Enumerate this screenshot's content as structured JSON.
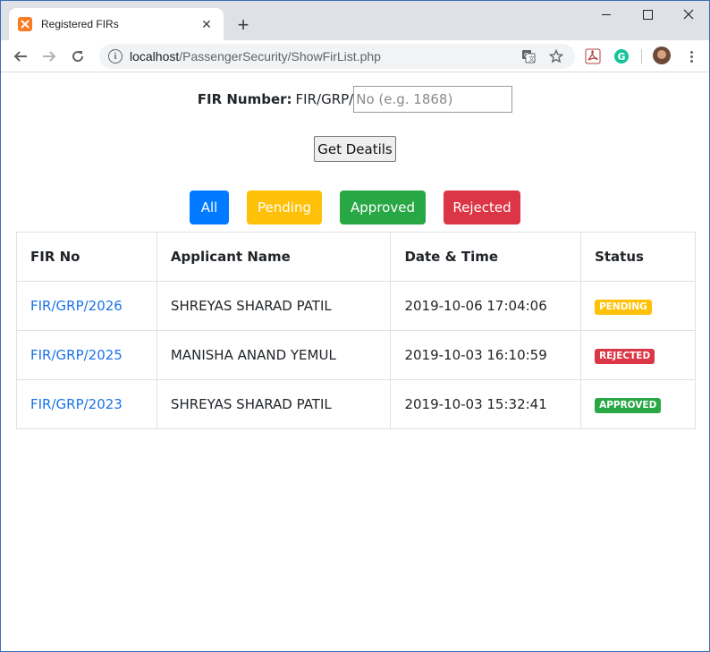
{
  "browser": {
    "tab_title": "Registered FIRs",
    "url_host": "localhost",
    "url_path": "/PassengerSecurity/ShowFirList.php"
  },
  "form": {
    "label": "FIR Number:",
    "prefix": "FIR/GRP/",
    "placeholder": "No (e.g. 1868)",
    "button": "Get Deatils"
  },
  "filters": {
    "all": "All",
    "pending": "Pending",
    "approved": "Approved",
    "rejected": "Rejected"
  },
  "table": {
    "headers": [
      "FIR No",
      "Applicant Name",
      "Date & Time",
      "Status"
    ],
    "rows": [
      {
        "fir": "FIR/GRP/2026",
        "name": "SHREYAS SHARAD PATIL",
        "datetime": "2019-10-06 17:04:06",
        "status": "PENDING"
      },
      {
        "fir": "FIR/GRP/2025",
        "name": "MANISHA ANAND YEMUL",
        "datetime": "2019-10-03 16:10:59",
        "status": "REJECTED"
      },
      {
        "fir": "FIR/GRP/2023",
        "name": "SHREYAS SHARAD PATIL",
        "datetime": "2019-10-03 15:32:41",
        "status": "APPROVED"
      }
    ]
  },
  "colors": {
    "all": "#007bff",
    "pending": "#ffc107",
    "approved": "#28a745",
    "rejected": "#dc3545",
    "link": "#1a73e8"
  },
  "icons": [
    "xampp-favicon-icon",
    "close-tab-icon",
    "new-tab-icon",
    "minimize-icon",
    "maximize-icon",
    "close-window-icon",
    "back-arrow-icon",
    "forward-arrow-icon",
    "reload-icon",
    "info-icon",
    "translate-icon",
    "star-icon",
    "pdf-extension-icon",
    "grammarly-icon",
    "profile-avatar",
    "menu-icon"
  ]
}
